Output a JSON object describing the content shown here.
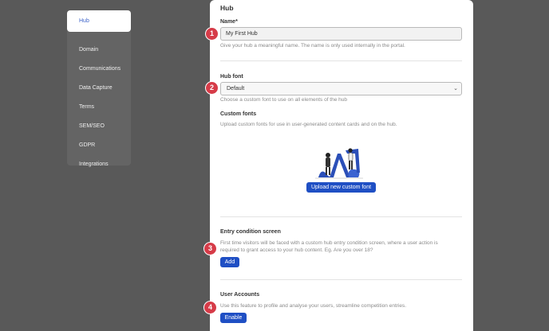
{
  "sidebar": {
    "items": [
      {
        "label": "Hub"
      },
      {
        "label": "Domain"
      },
      {
        "label": "Communications"
      },
      {
        "label": "Data Capture"
      },
      {
        "label": "Terms"
      },
      {
        "label": "SEM/SEO"
      },
      {
        "label": "GDPR"
      },
      {
        "label": "Integrations"
      }
    ]
  },
  "main": {
    "title": "Hub",
    "name_label": "Name*",
    "name_value": "My First Hub",
    "name_help": "Give your hub a meaningful name. The name is only used internally in the portal.",
    "font_label": "Hub font",
    "font_value": "Default",
    "font_help": "Choose a custom font to use on all elements of the hub",
    "custom_fonts_label": "Custom fonts",
    "custom_fonts_help": "Upload custom fonts for use in user-generated content cards and on the hub.",
    "upload_button": "Upload new custom font",
    "entry_label": "Entry condition screen",
    "entry_help_1": "First time visitors will be faced with a custom hub entry condition screen, where a user action is",
    "entry_help_2": "required to grant access to your hub content. Eg. Are you over 18?",
    "add_button": "Add",
    "accounts_label": "User Accounts",
    "accounts_help": "Use this feature to profile and analyse your users, streamline competition entries.",
    "enable_button": "Enable"
  },
  "badges": [
    "1",
    "2",
    "3",
    "4"
  ],
  "colors": {
    "accent": "#1f4fc4",
    "badge": "#d63b48",
    "background": "#595959"
  }
}
